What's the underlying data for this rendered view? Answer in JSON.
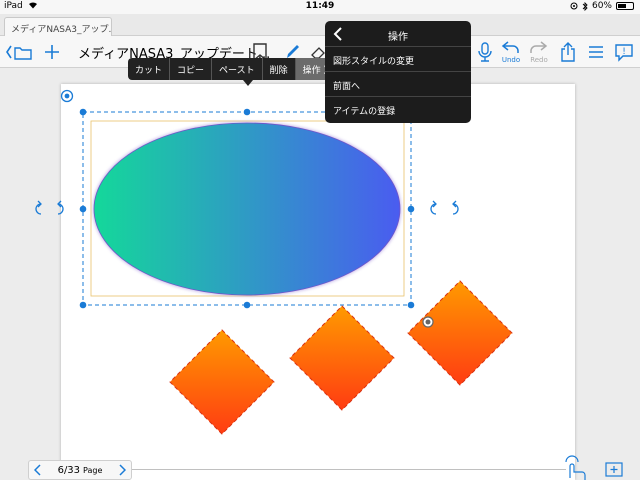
{
  "status": {
    "device": "iPad",
    "time": "11:49",
    "battery": "60%",
    "battery_level": 0.6
  },
  "tab": {
    "label": "メディアNASA3_アップ..."
  },
  "toolbar": {
    "doc_title": "メディアNASA3_アップデート...",
    "undo_label": "Undo",
    "redo_label": "Redo"
  },
  "edit_menu": {
    "items": [
      "カット",
      "コピー",
      "ペースト",
      "削除",
      "操作 〉"
    ]
  },
  "popover": {
    "title": "操作",
    "items": [
      "図形スタイルの変更",
      "前面へ",
      "アイテムの登録"
    ]
  },
  "pager": {
    "page": "6/33",
    "page_label": "Page"
  },
  "colors": {
    "accent": "#1a7bd6",
    "ellipse_start": "#14d89a",
    "ellipse_end": "#4a5cf0",
    "diamond_top": "#ff9a00",
    "diamond_bottom": "#ff3c12",
    "selection": "#1a7bd6"
  }
}
